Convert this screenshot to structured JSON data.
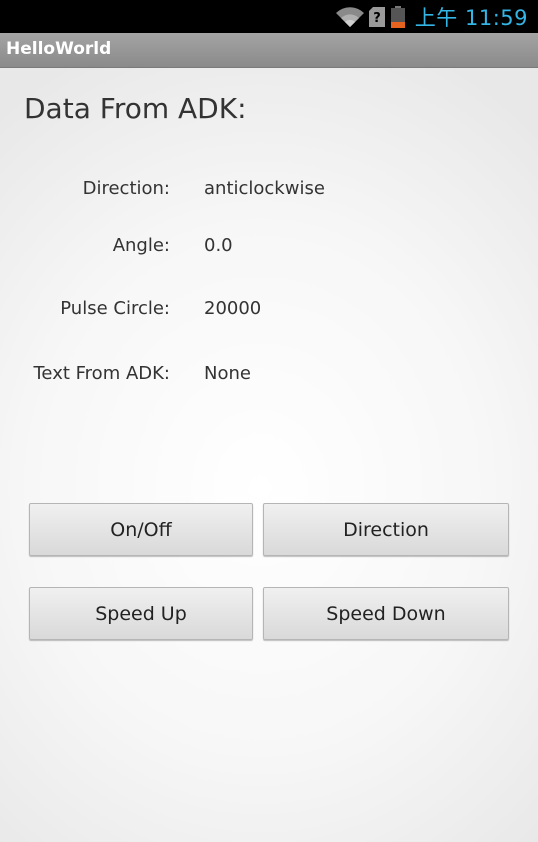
{
  "status_bar": {
    "time": "上午 11:59",
    "icons": [
      "wifi-icon",
      "sim-unknown-icon",
      "battery-low-icon"
    ],
    "time_color": "#33b5e5"
  },
  "app": {
    "title": "HelloWorld"
  },
  "main": {
    "heading": "Data From ADK:",
    "rows": [
      {
        "label": "Direction:",
        "value": "anticlockwise"
      },
      {
        "label": "Angle:",
        "value": "0.0"
      },
      {
        "label": "Pulse Circle:",
        "value": "20000"
      },
      {
        "label": "Text From ADK:",
        "value": "None"
      }
    ],
    "buttons": {
      "on_off": "On/Off",
      "direction": "Direction",
      "speed_up": "Speed Up",
      "speed_down": "Speed Down"
    }
  }
}
